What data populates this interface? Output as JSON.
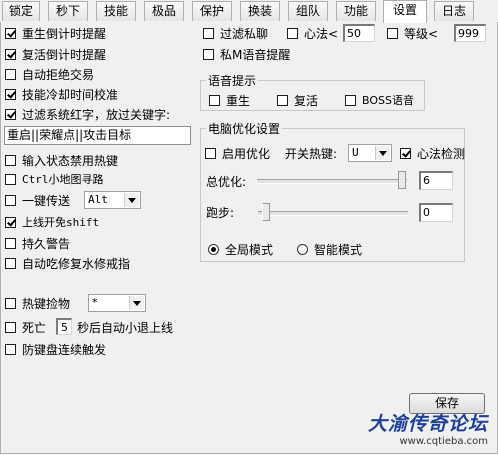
{
  "tabs": [
    "锁定",
    "秒下",
    "技能",
    "极品",
    "保护",
    "换装",
    "组队",
    "功能",
    "设置",
    "日志"
  ],
  "active_tab": "设置",
  "left": {
    "respawn_countdown": {
      "label": "重生倒计时提醒",
      "checked": true
    },
    "revive_countdown": {
      "label": "复活倒计时提醒",
      "checked": true
    },
    "auto_reject_trade": {
      "label": "自动拒绝交易",
      "checked": false
    },
    "skill_cooldown_sync": {
      "label": "技能冷却时间校准",
      "checked": true
    },
    "filter_system_red": {
      "label": "过滤系统红字，放过关键字:",
      "checked": true
    },
    "keyword_value": "重启||荣耀点||攻击目标",
    "input_disable_hotkey": {
      "label": "输入状态禁用热键",
      "checked": false
    },
    "ctrl_minimap_path": {
      "label": "Ctrl小地图寻路",
      "checked": false
    },
    "one_key_teleport": {
      "label": "一键传送",
      "checked": false
    },
    "teleport_key": "Alt",
    "login_shift": {
      "label": "上线开免shift",
      "checked": true
    },
    "durability_warning": {
      "label": "持久警告",
      "checked": false
    },
    "auto_eat_repair": {
      "label": "自动吃修复水修戒指",
      "checked": false
    },
    "hotkey_pickup": {
      "label": "热键捡物",
      "checked": false
    },
    "pickup_key": "*",
    "death": {
      "label": "死亡",
      "checked": false
    },
    "death_seconds": "5",
    "death_after": "秒后自动小退上线",
    "anti_key_repeat": {
      "label": "防键盘连续触发",
      "checked": false
    }
  },
  "right": {
    "filter_private_chat": {
      "label": "过滤私聊",
      "checked": false
    },
    "mind_method_lt": {
      "label": "心法<",
      "checked": false
    },
    "mind_method_value": "50",
    "level_lt": {
      "label": "等级<",
      "checked": false
    },
    "level_value": "999",
    "private_m_voice": {
      "label": "私M语音提醒",
      "checked": false
    },
    "voice_group": {
      "title": "语音提示",
      "respawn": {
        "label": "重生",
        "checked": false
      },
      "revive": {
        "label": "复活",
        "checked": false
      },
      "boss": {
        "label": "BOSS语音",
        "checked": false
      }
    },
    "pc_group": {
      "title": "电脑优化设置",
      "enable": {
        "label": "启用优化",
        "checked": false
      },
      "switch_hotkey_label": "开关热键:",
      "switch_hotkey_value": "U",
      "mind_detect": {
        "label": "心法检测",
        "checked": true
      },
      "total_label": "总优化:",
      "total_value": "6",
      "run_label": "跑步:",
      "run_value": "0",
      "mode_global": {
        "label": "全局模式",
        "checked": true
      },
      "mode_smart": {
        "label": "智能模式",
        "checked": false
      }
    }
  },
  "save_button": "保存",
  "watermark": {
    "title": "大渝传奇论坛",
    "url": "www.cqtieba.com"
  }
}
